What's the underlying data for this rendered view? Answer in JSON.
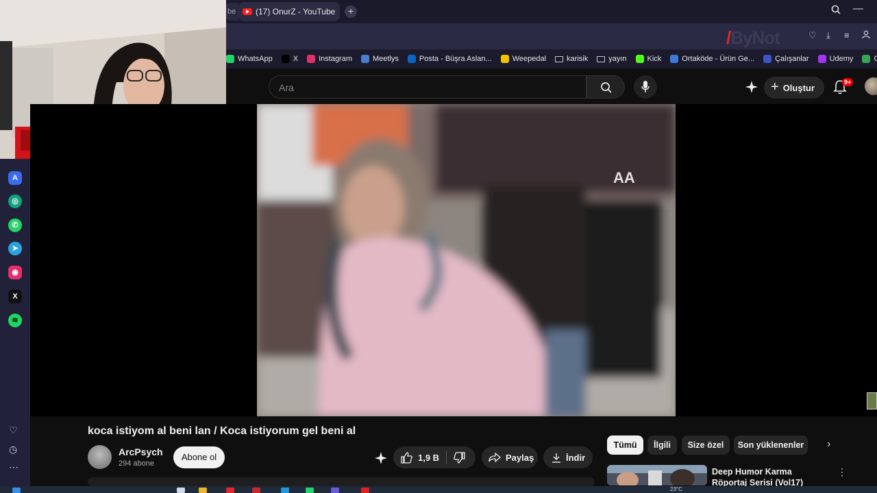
{
  "browser": {
    "prev_tab_label": "be",
    "active_tab_title": "(17) OnurZ - YouTube",
    "new_tab_symbol": "+",
    "search_icon": "magnifier-icon",
    "minimize_symbol": "—"
  },
  "watermark": {
    "brand": "ByNot"
  },
  "bookmarks": [
    {
      "label": "WhatsApp",
      "color": "#25d366",
      "kind": "site"
    },
    {
      "label": "X",
      "color": "#000000",
      "kind": "x"
    },
    {
      "label": "Instagram",
      "color": "#e1306c",
      "kind": "site"
    },
    {
      "label": "Meetlys",
      "color": "#4a7bd0",
      "kind": "site"
    },
    {
      "label": "Posta - Büşra Aslan...",
      "color": "#0a66c2",
      "kind": "site"
    },
    {
      "label": "Weepedal",
      "color": "#f2c200",
      "kind": "site"
    },
    {
      "label": "karisik",
      "kind": "folder"
    },
    {
      "label": "yayın",
      "kind": "folder"
    },
    {
      "label": "Kick",
      "color": "#53fc18",
      "kind": "site"
    },
    {
      "label": "Ortaköde - Ürün Ge...",
      "color": "#3d7bd9",
      "kind": "site"
    },
    {
      "label": "Çalışanlar",
      "color": "#3d56c4",
      "kind": "site"
    },
    {
      "label": "Udemy",
      "color": "#a435f0",
      "kind": "site"
    },
    {
      "label": "Google Haritalar",
      "color": "#34a853",
      "kind": "site"
    }
  ],
  "youtube": {
    "search_placeholder": "Ara",
    "create_label": "Oluştur",
    "notification_badge": "9+",
    "video": {
      "title": "koca istiyom al beni lan / Koca istiyorum gel beni al",
      "watermark_text": "AA",
      "channel_name": "ArcPsych",
      "subscribers": "294 abone",
      "subscribe_label": "Abone ol",
      "like_count": "1,9 B",
      "share_label": "Paylaş",
      "download_label": "İndir"
    },
    "chips": [
      "Tümü",
      "İlgili",
      "Size özel",
      "Son yüklenenler"
    ],
    "recommendation": {
      "title": "Deep Humor Karma Röportaj Serisi (Vol17)"
    }
  },
  "taskbar": {
    "temperature": "23°C"
  },
  "colors": {
    "youtube_red": "#ff0000",
    "opera_sidebar": "#22213a",
    "accent_red": "#e0262a"
  }
}
